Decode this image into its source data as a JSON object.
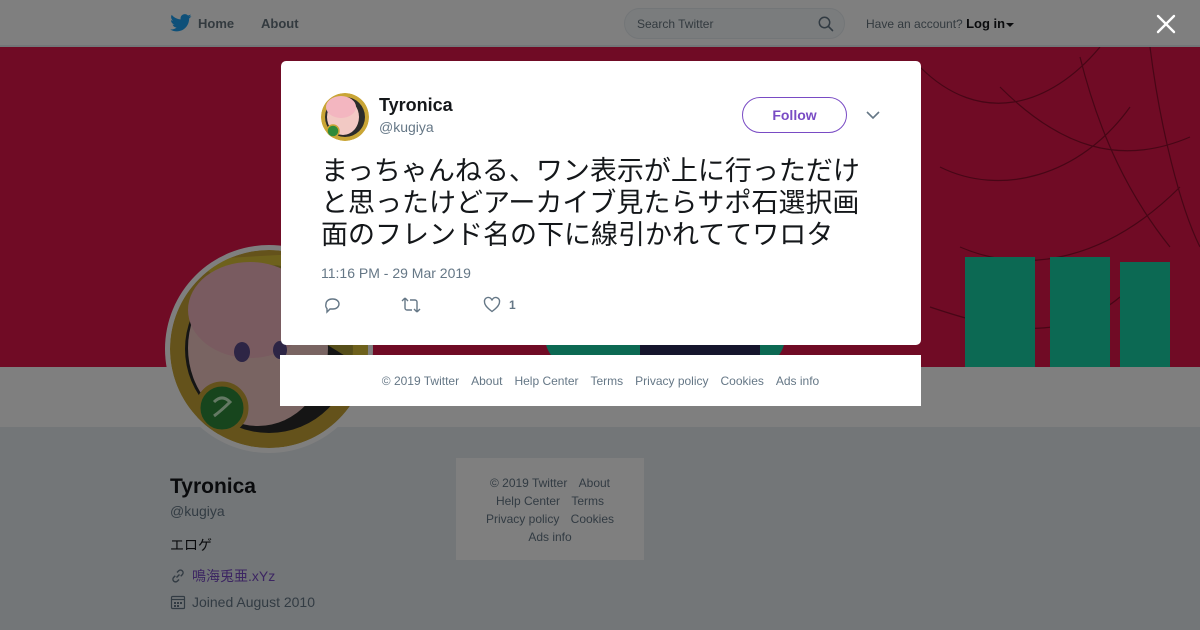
{
  "topbar": {
    "home_label": "Home",
    "about_label": "About",
    "search_placeholder": "Search Twitter",
    "account_prompt": "Have an account?",
    "login_label": "Log in"
  },
  "profile": {
    "name": "Tyronica",
    "handle": "@kugiya",
    "bio": "エロゲ",
    "link": "鳴海兎亜.xYz",
    "joined": "Joined August 2010"
  },
  "side_footer": {
    "links": [
      "© 2019 Twitter",
      "About",
      "Help Center",
      "Terms",
      "Privacy policy",
      "Cookies",
      "Ads info"
    ]
  },
  "tweet": {
    "author_name": "Tyronica",
    "author_handle": "@kugiya",
    "follow_label": "Follow",
    "text": "まっちゃんねる、ワン表示が上に行っただけと思ったけどアーカイブ見たらサポ石選択画面のフレンド名の下に線引かれててワロタ",
    "timestamp": "11:16 PM - 29 Mar 2019",
    "like_count": "1"
  },
  "modal_footer": {
    "links": [
      "© 2019 Twitter",
      "About",
      "Help Center",
      "Terms",
      "Privacy policy",
      "Cookies",
      "Ads info"
    ]
  },
  "colors": {
    "brand_blue": "#1da1f2",
    "accent_purple": "#794bc4",
    "banner_red": "#e0164a"
  },
  "icons": [
    "twitter-bird-icon",
    "search-icon",
    "close-icon",
    "chevron-down-icon",
    "reply-icon",
    "retweet-icon",
    "like-icon",
    "link-icon",
    "calendar-icon"
  ]
}
